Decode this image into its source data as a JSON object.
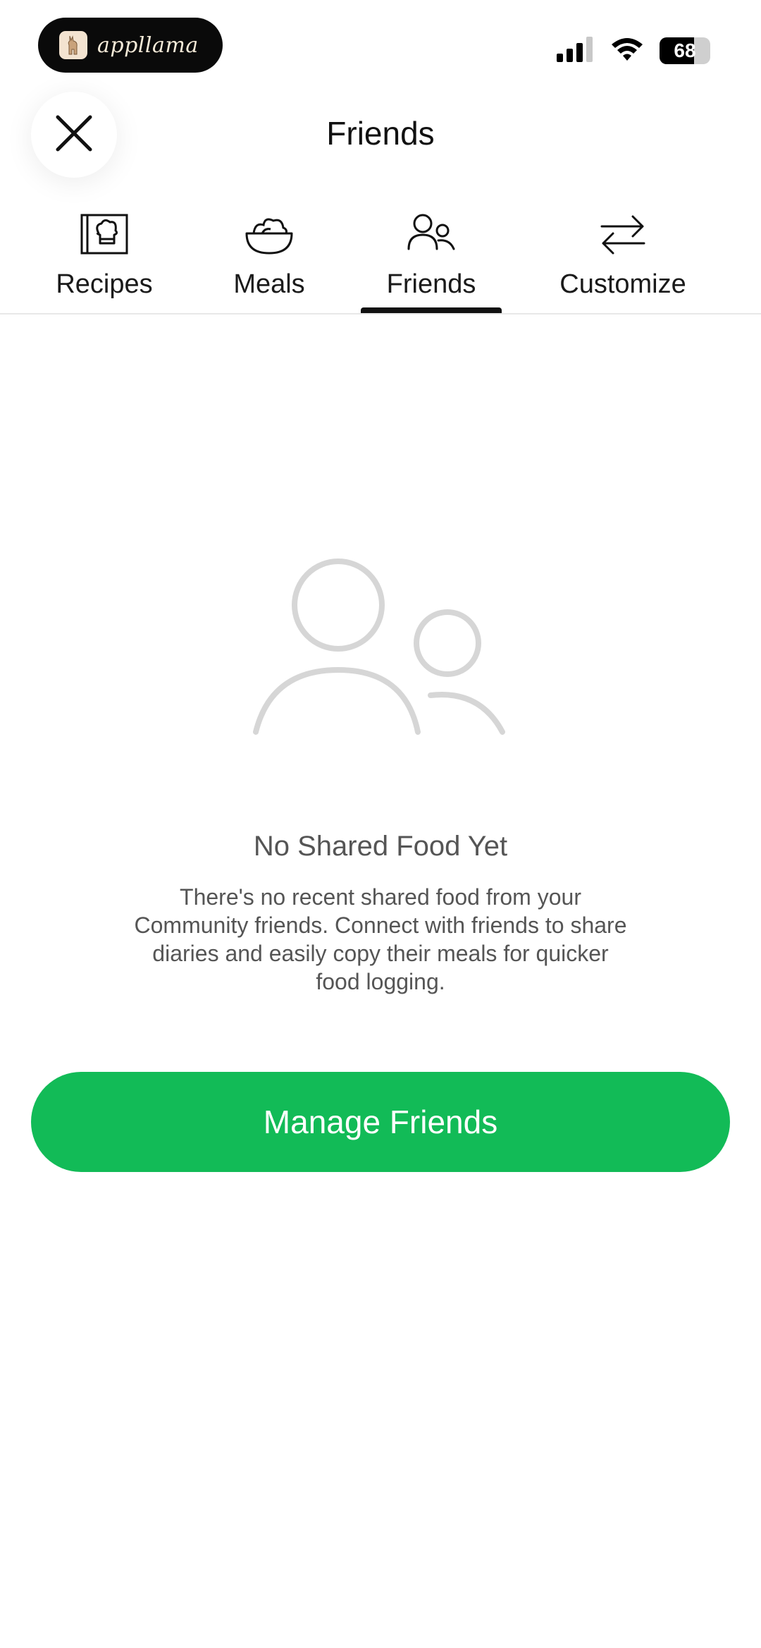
{
  "status_bar": {
    "app_pill_label": "appllama",
    "battery_level": "68",
    "battery_fraction": 0.68
  },
  "header": {
    "title": "Friends",
    "close_icon": "close-icon"
  },
  "tabs": [
    {
      "label": "Recipes",
      "icon": "recipe-book-icon",
      "selected": false
    },
    {
      "label": "Meals",
      "icon": "bowl-icon",
      "selected": false
    },
    {
      "label": "Friends",
      "icon": "friends-icon",
      "selected": true
    },
    {
      "label": "Customize",
      "icon": "swap-arrows-icon",
      "selected": false
    }
  ],
  "empty_state": {
    "icon": "friends-icon",
    "title": "No Shared Food Yet",
    "description": "There's no recent shared food from your Community friends. Connect with friends to share diaries and easily copy their meals for quicker food logging."
  },
  "primary_action": {
    "label": "Manage Friends"
  },
  "colors": {
    "accent_green": "#12bb57",
    "illustration_gray": "#d6d6d6",
    "text_dark": "#111111",
    "text_muted": "#555555"
  }
}
